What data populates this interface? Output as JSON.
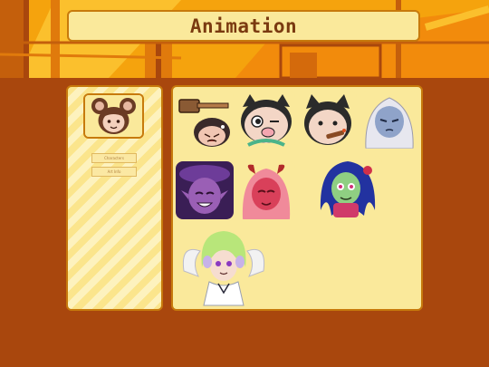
{
  "header": {
    "title": "Animation"
  },
  "sidebar": {
    "avatar_icon": "chibi-bear-avatar-icon",
    "buttons": [
      {
        "label": "Characters"
      },
      {
        "label": "Art Info"
      }
    ]
  },
  "gallery": {
    "items": [
      {
        "icon": "hammer-bonk-emote-icon"
      },
      {
        "icon": "winking-cat-emote-icon"
      },
      {
        "icon": "cigar-cat-emote-icon"
      },
      {
        "icon": "blue-skin-girl-emote-icon"
      },
      {
        "icon": "purple-demon-emote-icon"
      },
      {
        "icon": "red-horned-demon-emote-icon"
      },
      {
        "icon": "green-zombie-girl-emote-icon"
      },
      {
        "icon": "winged-angel-character-icon"
      }
    ]
  },
  "colors": {
    "background": "#a9470d",
    "banner": "#f5a30d",
    "panel": "#fae99b",
    "border": "#c77a0c",
    "title_text": "#7a3a10"
  }
}
